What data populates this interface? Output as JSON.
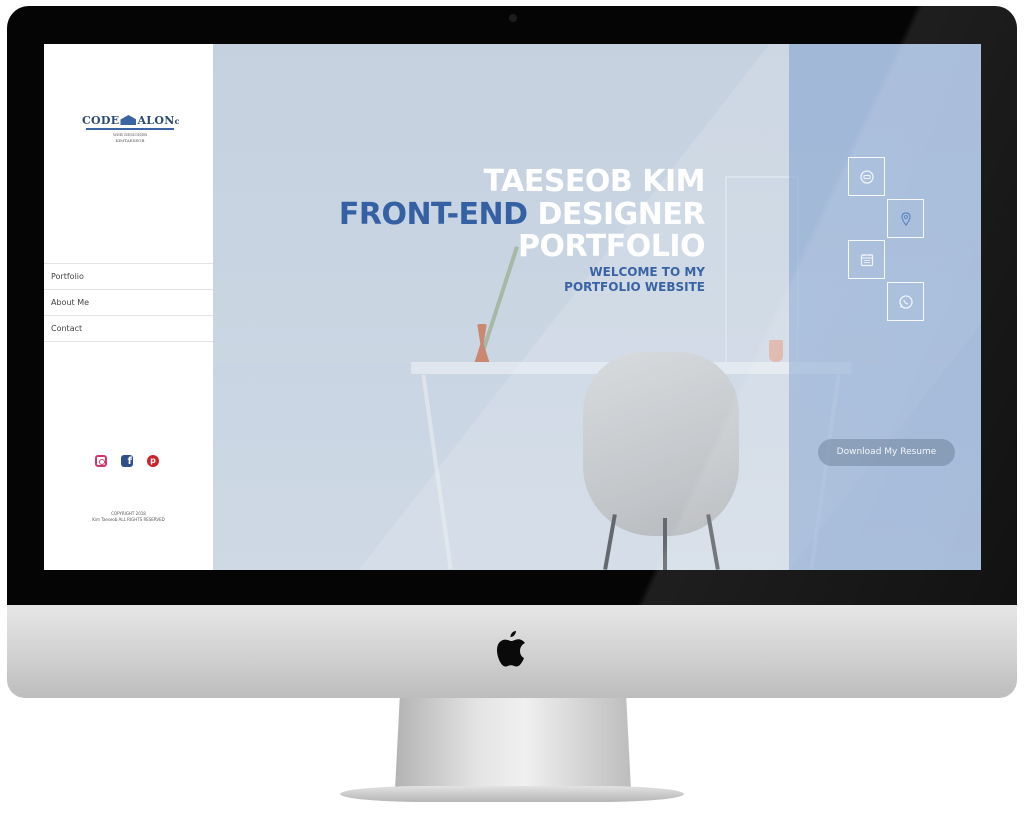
{
  "logo": {
    "brand": "CODE   ALON",
    "brand_left": "CODE",
    "brand_right": "ALON",
    "subtitle_1": "WEB DESIGNER",
    "subtitle_2": "KIMTAESEOB"
  },
  "sidebar": {
    "nav": [
      {
        "label": "Portfolio"
      },
      {
        "label": "About Me"
      },
      {
        "label": "Contact"
      }
    ],
    "social_icons": [
      "instagram-icon",
      "facebook-icon",
      "pinterest-icon"
    ],
    "copyright_1": "COPYRIGHT 2018",
    "copyright_2": "Kim Taeseob ALL RIGHTS RESERVED"
  },
  "hero": {
    "name": "TAESEOB KIM",
    "role_accent": "FRONT-END",
    "role_rest": " DESIGNER",
    "portfolio": "PORTFOLIO",
    "welcome": "WELCOME TO MY PORTFOLIO WEBSITE"
  },
  "contact_icons": [
    "chat-icon",
    "location-icon",
    "calendar-icon",
    "whatsapp-icon"
  ],
  "resume_button": "Download My Resume",
  "colors": {
    "accent": "#3560a3",
    "panel": "#8aa6d0",
    "background": "#c8d5e3"
  }
}
